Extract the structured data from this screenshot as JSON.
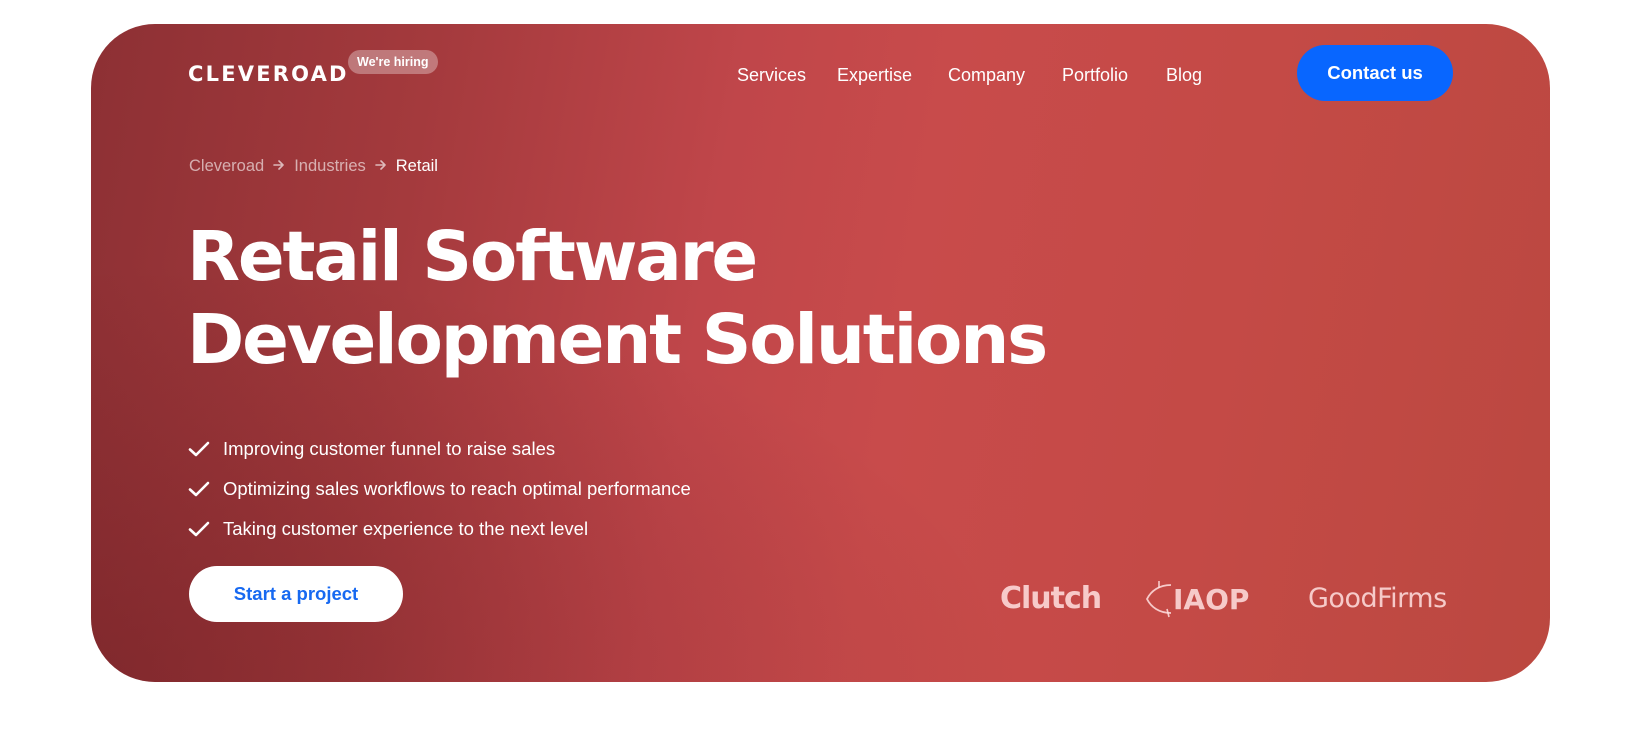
{
  "header": {
    "logo": "CLEVEROAD",
    "hiring_badge": "We're hiring",
    "nav": [
      {
        "label": "Services"
      },
      {
        "label": "Expertise"
      },
      {
        "label": "Company"
      },
      {
        "label": "Portfolio"
      },
      {
        "label": "Blog"
      }
    ],
    "contact_button": "Contact us"
  },
  "breadcrumb": [
    {
      "label": "Cleveroad"
    },
    {
      "label": "Industries"
    },
    {
      "label": "Retail"
    }
  ],
  "hero": {
    "title_line1": "Retail Software",
    "title_line2": "Development Solutions",
    "features": [
      {
        "icon": "check-icon",
        "text": "Improving customer funnel to raise sales"
      },
      {
        "icon": "check-icon",
        "text": "Optimizing sales workflows to reach optimal performance"
      },
      {
        "icon": "check-icon",
        "text": "Taking customer experience to the next level"
      }
    ],
    "cta_button": "Start a project"
  },
  "badges": [
    {
      "name": "Clutch"
    },
    {
      "name": "IAOP"
    },
    {
      "name": "GoodFirms"
    }
  ],
  "colors": {
    "primary_blue": "#0866ff",
    "cta_text_blue": "#1769f1",
    "hero_red_dark": "#8d3034",
    "hero_red_light": "#c84b4b"
  }
}
